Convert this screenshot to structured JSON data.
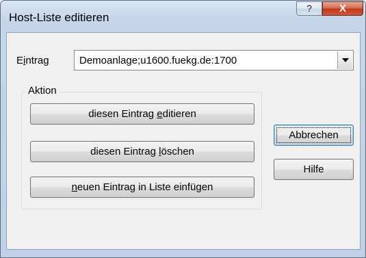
{
  "window": {
    "title": "Host-Liste editieren",
    "help_glyph": "?",
    "close_glyph": "X"
  },
  "entry": {
    "label_pre": "E",
    "label_acc": "i",
    "label_post": "ntrag",
    "value": "Demoanlage;u1600.fuekg.de:1700"
  },
  "action_group": {
    "legend": "Aktion",
    "edit": {
      "pre": "diesen Eintrag ",
      "acc": "e",
      "post": "ditieren"
    },
    "delete": {
      "pre": "diesen Eintrag ",
      "acc": "l",
      "post": "öschen"
    },
    "insert": {
      "pre": "",
      "acc": "n",
      "post": "euen Eintrag in Liste einfügen"
    }
  },
  "side_buttons": {
    "cancel": "Abbrechen",
    "help": "Hilfe"
  },
  "colors": {
    "close_button": "#c0391d",
    "default_button_border": "#3c7fb1",
    "dialog_background": "#f0f0f0"
  },
  "icons": {
    "help": "question-mark-icon",
    "close": "close-icon",
    "dropdown": "chevron-down-icon"
  }
}
